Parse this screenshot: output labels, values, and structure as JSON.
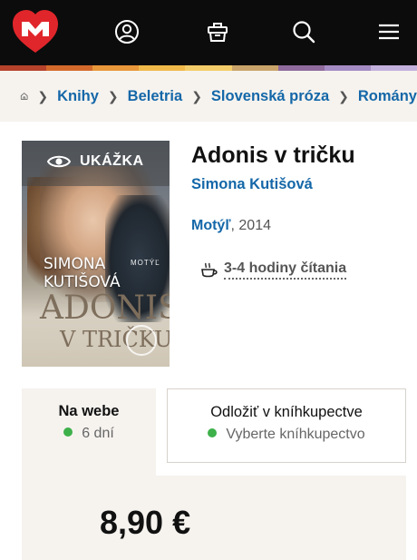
{
  "header": {
    "icons": [
      "logo-icon",
      "account-icon",
      "cart-icon",
      "search-icon",
      "menu-icon"
    ],
    "background": "#0c0c0c",
    "logo_color": "#e0262b",
    "stripe_colors": [
      "#b5422b",
      "#d36a2c",
      "#e8973a",
      "#f0b94a",
      "#f3cc6a",
      "#c9a46a",
      "#8f6a9c",
      "#a58bc4",
      "#c2b0dc"
    ]
  },
  "breadcrumb": {
    "items": [
      "Knihy",
      "Beletria",
      "Slovenská próza",
      "Romány"
    ],
    "link_color": "#1467a8"
  },
  "cover": {
    "sample_label": "UKÁŽKA",
    "author_line1": "SIMONA",
    "author_line2": "KUTIŠOVÁ",
    "publisher": "MOTÝĽ",
    "title_line1": "ADONIS",
    "title_line2": "V TRIČKU"
  },
  "book": {
    "title": "Adonis v tričku",
    "author": "Simona Kutišová",
    "publisher": "Motýľ",
    "year": ", 2014",
    "reading_time": "3-4 hodiny čítania"
  },
  "availability": {
    "web": {
      "title": "Na webe",
      "status": "6 dní"
    },
    "store": {
      "title": "Odložiť v kníhkupectve",
      "status": "Vyberte kníhkupectvo"
    },
    "status_color": "#3db04a"
  },
  "price": "8,90 €"
}
